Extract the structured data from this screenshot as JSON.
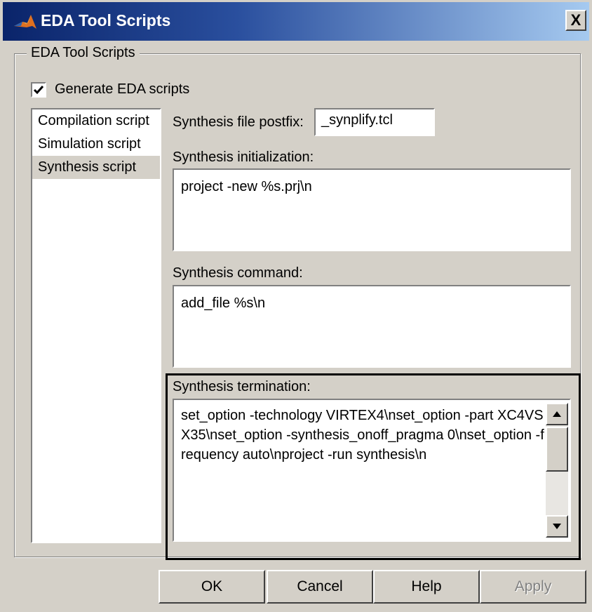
{
  "window": {
    "title": "EDA Tool Scripts",
    "close_label": "X"
  },
  "group": {
    "legend": "EDA Tool Scripts"
  },
  "generate": {
    "label": "Generate EDA scripts",
    "checked": true
  },
  "script_list": {
    "items": [
      {
        "label": "Compilation script",
        "selected": false
      },
      {
        "label": "Simulation script",
        "selected": false
      },
      {
        "label": "Synthesis script",
        "selected": true
      }
    ]
  },
  "synthesis": {
    "postfix_label": "Synthesis file postfix:",
    "postfix_value": "_synplify.tcl",
    "init_label": "Synthesis initialization:",
    "init_value": "project -new %s.prj\\n",
    "command_label": "Synthesis command:",
    "command_value": "add_file %s\\n",
    "termination_label": "Synthesis termination:",
    "termination_value": "set_option -technology VIRTEX4\\nset_option -part XC4VSX35\\nset_option -synthesis_onoff_pragma 0\\nset_option -frequency auto\\nproject -run synthesis\\n"
  },
  "buttons": {
    "ok": "OK",
    "cancel": "Cancel",
    "help": "Help",
    "apply": "Apply"
  }
}
